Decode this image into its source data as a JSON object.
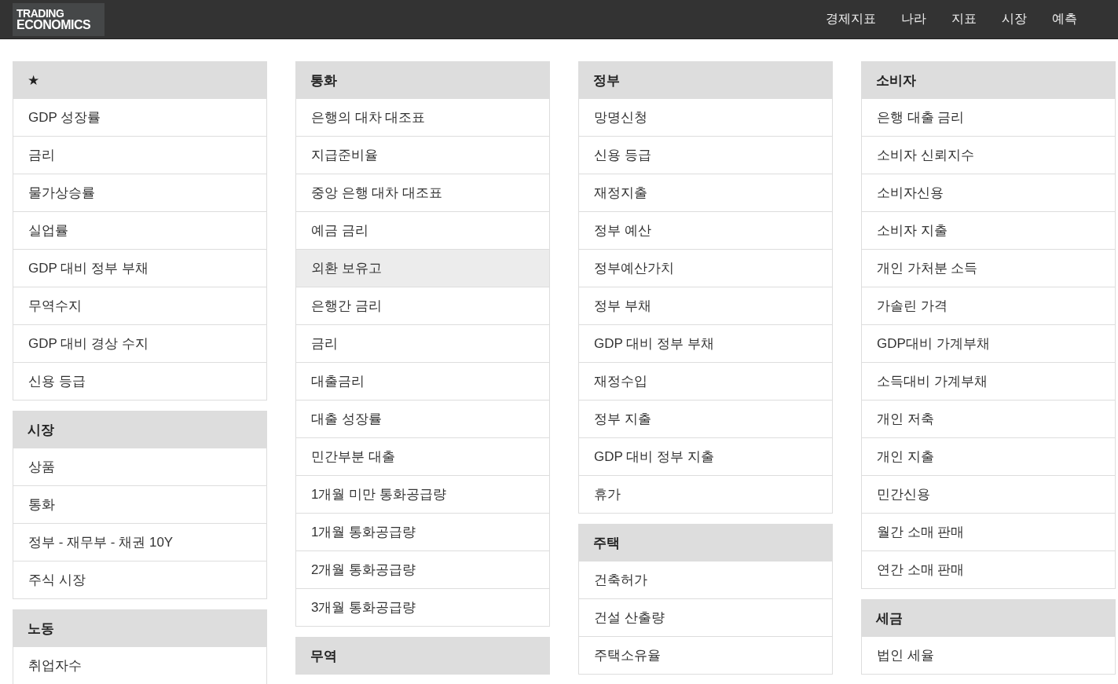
{
  "logo": {
    "line_1": "TRADING",
    "line_2": "ECONOMICS"
  },
  "nav": [
    "경제지표",
    "나라",
    "지표",
    "시장",
    "예측"
  ],
  "columns": [
    {
      "panels": [
        {
          "heading": "★",
          "items": [
            {
              "label": "GDP 성장률",
              "highlighted": false
            },
            {
              "label": "금리",
              "highlighted": false
            },
            {
              "label": "물가상승률",
              "highlighted": false
            },
            {
              "label": "실업률",
              "highlighted": false
            },
            {
              "label": "GDP 대비 정부 부채",
              "highlighted": false
            },
            {
              "label": "무역수지",
              "highlighted": false
            },
            {
              "label": "GDP 대비 경상 수지",
              "highlighted": false
            },
            {
              "label": "신용 등급",
              "highlighted": false
            }
          ]
        },
        {
          "heading": "시장",
          "items": [
            {
              "label": "상품",
              "highlighted": false
            },
            {
              "label": "통화",
              "highlighted": false
            },
            {
              "label": "정부 - 재무부 - 채권 10Y",
              "highlighted": false
            },
            {
              "label": "주식 시장",
              "highlighted": false
            }
          ]
        },
        {
          "heading": "노동",
          "items": [
            {
              "label": "취업자수",
              "highlighted": false
            }
          ]
        }
      ]
    },
    {
      "panels": [
        {
          "heading": "통화",
          "items": [
            {
              "label": "은행의 대차 대조표",
              "highlighted": false
            },
            {
              "label": "지급준비율",
              "highlighted": false
            },
            {
              "label": "중앙 은행 대차 대조표",
              "highlighted": false
            },
            {
              "label": "예금 금리",
              "highlighted": false
            },
            {
              "label": "외환 보유고",
              "highlighted": true
            },
            {
              "label": "은행간 금리",
              "highlighted": false
            },
            {
              "label": "금리",
              "highlighted": false
            },
            {
              "label": "대출금리",
              "highlighted": false
            },
            {
              "label": "대출 성장률",
              "highlighted": false
            },
            {
              "label": "민간부분 대출",
              "highlighted": false
            },
            {
              "label": "1개월 미만 통화공급량",
              "highlighted": false
            },
            {
              "label": "1개월 통화공급량",
              "highlighted": false
            },
            {
              "label": "2개월 통화공급량",
              "highlighted": false
            },
            {
              "label": "3개월 통화공급량",
              "highlighted": false
            }
          ]
        },
        {
          "heading": "무역"
        }
      ]
    },
    {
      "panels": [
        {
          "heading": "정부",
          "items": [
            {
              "label": "망명신청",
              "highlighted": false
            },
            {
              "label": "신용 등급",
              "highlighted": false
            },
            {
              "label": "재정지출",
              "highlighted": false
            },
            {
              "label": "정부 예산",
              "highlighted": false
            },
            {
              "label": "정부예산가치",
              "highlighted": false
            },
            {
              "label": "정부 부채",
              "highlighted": false
            },
            {
              "label": "GDP 대비 정부 부채",
              "highlighted": false
            },
            {
              "label": "재정수입",
              "highlighted": false
            },
            {
              "label": "정부 지출",
              "highlighted": false
            },
            {
              "label": "GDP 대비 정부 지출",
              "highlighted": false
            },
            {
              "label": "휴가",
              "highlighted": false
            }
          ]
        },
        {
          "heading": "주택",
          "items": [
            {
              "label": "건축허가",
              "highlighted": false
            },
            {
              "label": "건설 산출량",
              "highlighted": false
            },
            {
              "label": "주택소유율",
              "highlighted": false
            }
          ]
        }
      ]
    },
    {
      "panels": [
        {
          "heading": "소비자",
          "items": [
            {
              "label": "은행 대출 금리",
              "highlighted": false
            },
            {
              "label": "소비자 신뢰지수",
              "highlighted": false
            },
            {
              "label": "소비자신용",
              "highlighted": false
            },
            {
              "label": "소비자 지출",
              "highlighted": false
            },
            {
              "label": "개인 가처분 소득",
              "highlighted": false
            },
            {
              "label": "가솔린 가격",
              "highlighted": false
            },
            {
              "label": "GDP대비 가계부채",
              "highlighted": false
            },
            {
              "label": "소득대비 가계부채",
              "highlighted": false
            },
            {
              "label": "개인 저축",
              "highlighted": false
            },
            {
              "label": "개인 지출",
              "highlighted": false
            },
            {
              "label": "민간신용",
              "highlighted": false
            },
            {
              "label": "월간 소매 판매",
              "highlighted": false
            },
            {
              "label": "연간 소매 판매",
              "highlighted": false
            }
          ]
        },
        {
          "heading": "세금",
          "items": [
            {
              "label": "법인 세율",
              "highlighted": false
            }
          ]
        }
      ]
    }
  ]
}
